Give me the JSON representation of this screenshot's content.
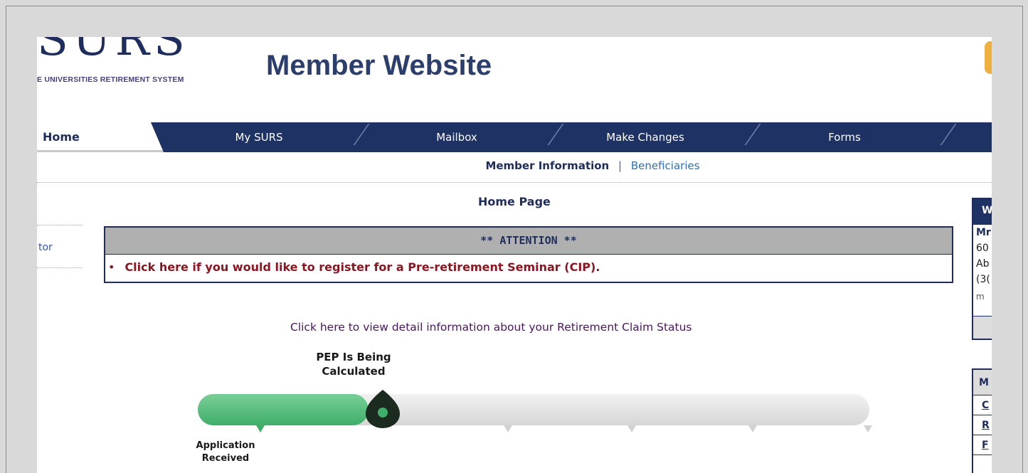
{
  "header": {
    "logo_letters": "SURS",
    "logo_subtitle": "E UNIVERSITIES RETIREMENT SYSTEM",
    "title": "Member Website"
  },
  "nav": {
    "items": [
      "Home",
      "My SURS",
      "Mailbox",
      "Make Changes",
      "Forms"
    ]
  },
  "subnav": {
    "active": "Member Information",
    "divider": "|",
    "link": "Beneficiaries"
  },
  "page": {
    "heading": "Home Page"
  },
  "sidebar": {
    "link_fragment": "tor"
  },
  "attention": {
    "header": "** ATTENTION **",
    "bullet": "•",
    "message": "Click here if you would like to register for a Pre-retirement Seminar (CIP)."
  },
  "claim": {
    "link": "Click here to view detail information about your Retirement Claim Status",
    "current_step": "PEP Is Being Calculated",
    "start_step": "Application Received"
  },
  "right_panel1": {
    "header": "W",
    "lines": [
      "Mr",
      "60",
      "Ab",
      "(3(",
      "m"
    ]
  },
  "right_panel2": {
    "header": "M",
    "links": [
      "C",
      "R",
      "F"
    ]
  },
  "colors": {
    "nav_bg": "#1e3264",
    "attention_text": "#8b1520",
    "claim_link": "#4b1660",
    "progress_green": "#3fae6a"
  },
  "icons": {
    "tracker_marker": "location-pin-icon"
  }
}
